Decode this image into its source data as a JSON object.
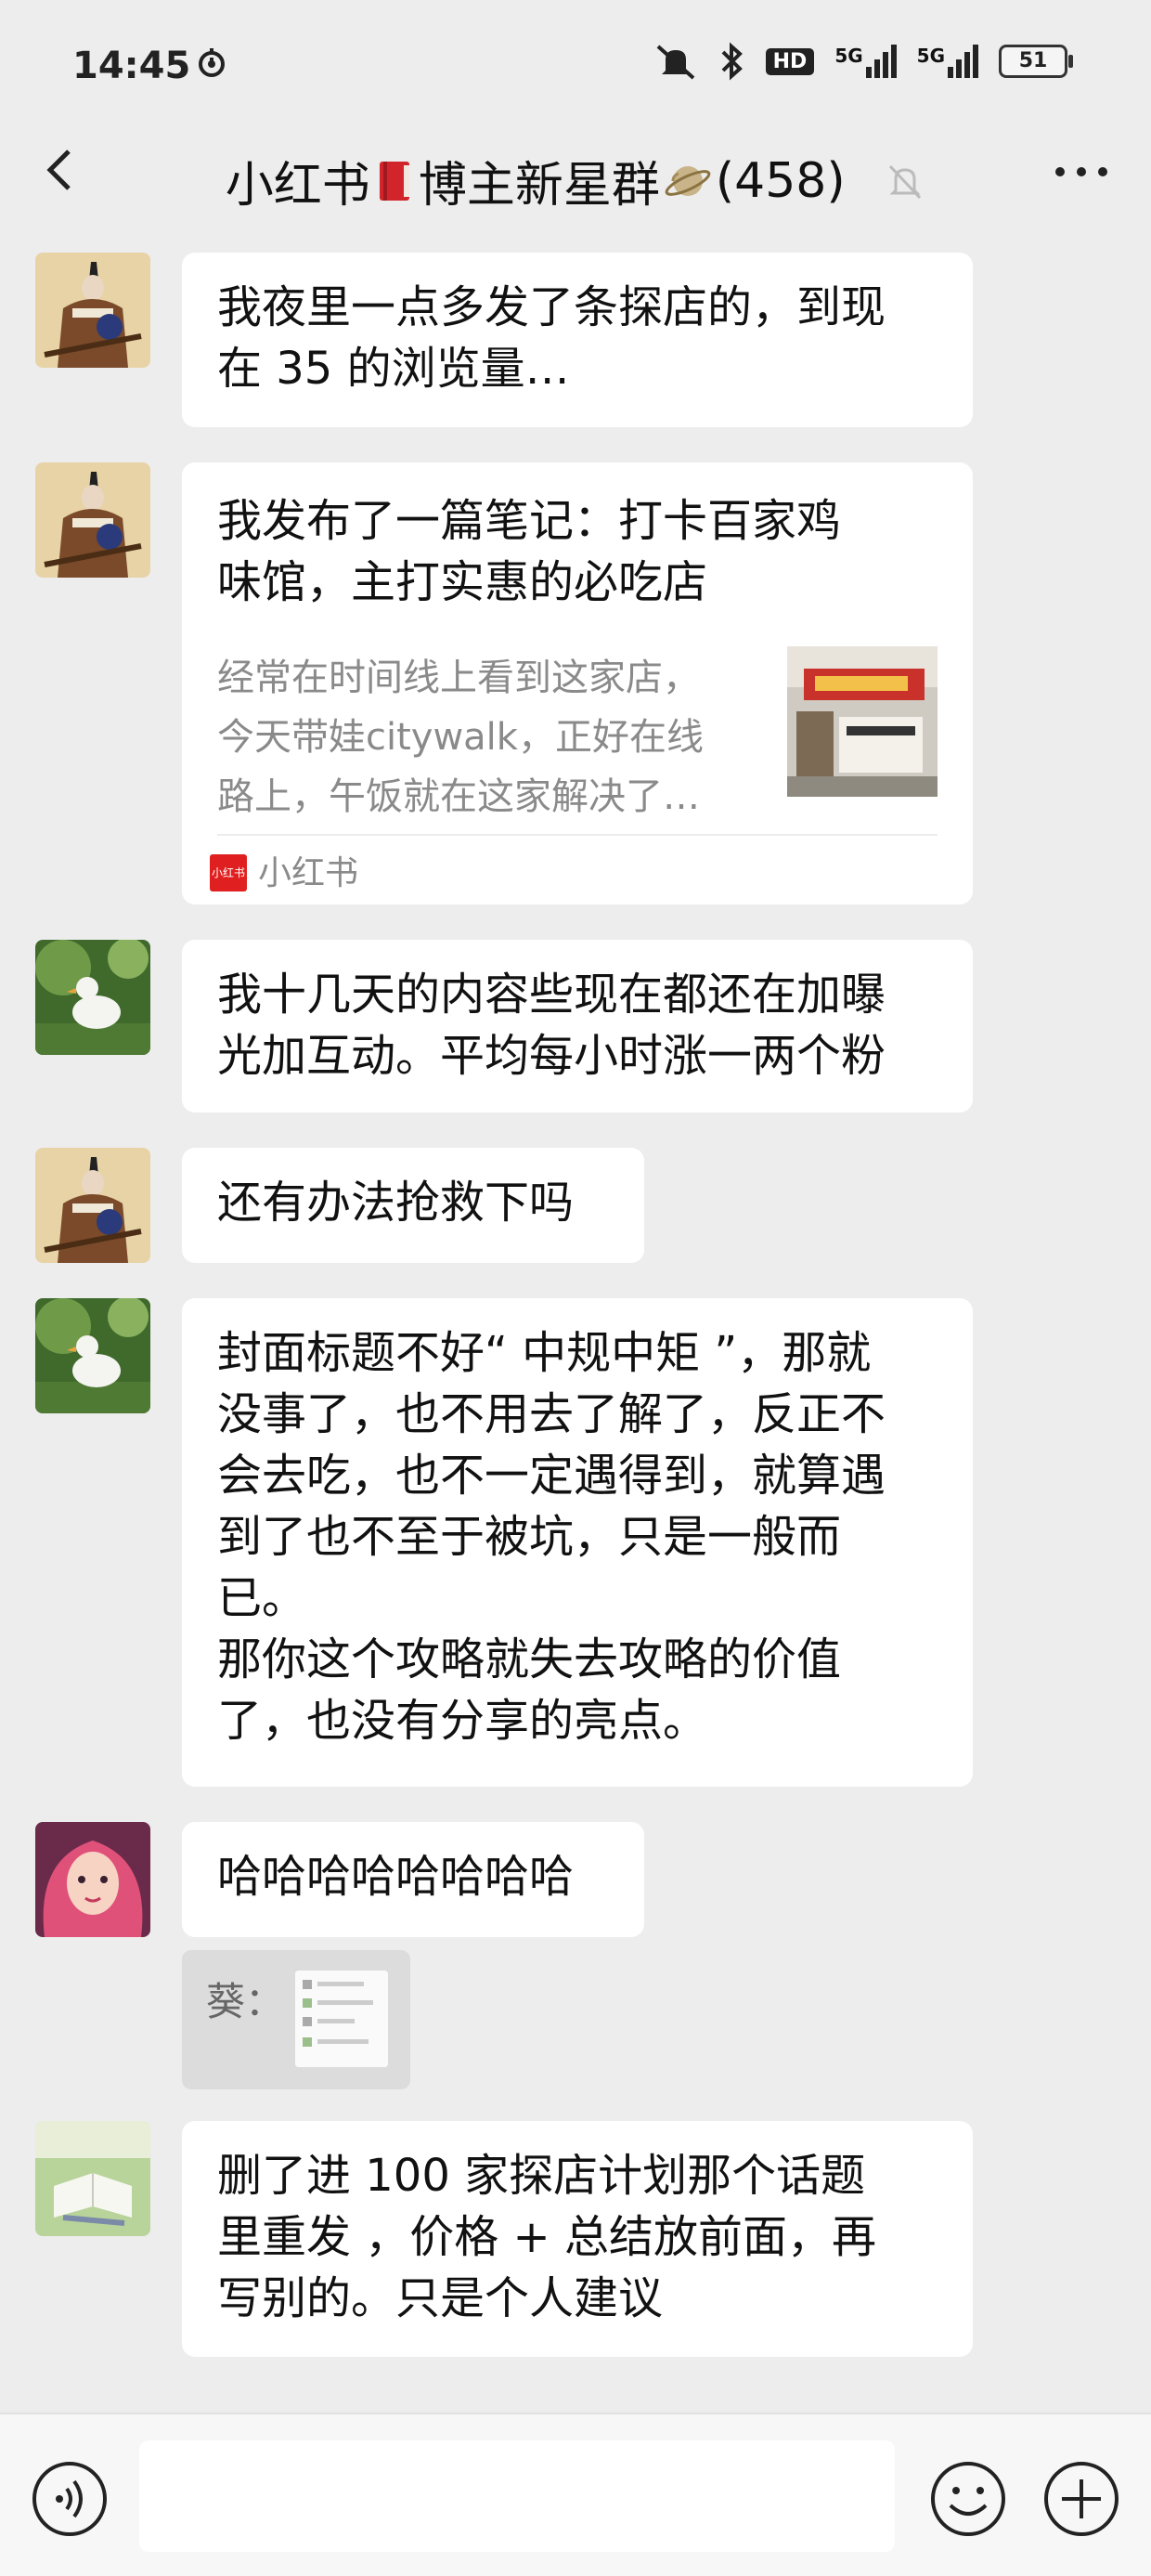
{
  "status_bar": {
    "time": "14:45",
    "network_1": "5G",
    "network_2": "5G",
    "hd": "HD",
    "battery": "51"
  },
  "header": {
    "title": "小红书",
    "title_suffix": "博主新星群",
    "member_count": "(458)",
    "icons": [
      "back-arrow-icon",
      "book-emoji-icon",
      "planet-emoji-icon",
      "mute-bell-icon",
      "more-icon"
    ]
  },
  "messages": [
    {
      "sender": "samurai",
      "lines": [
        "我夜里一点多发了条探店的，到现",
        "在 35 的浏览量…"
      ]
    },
    {
      "sender": "samurai",
      "card": {
        "title_lines": [
          "我发布了一篇笔记：打卡百家鸡",
          "味馆，主打实惠的必吃店"
        ],
        "desc_lines": [
          "经常在时间线上看到这家店，",
          "今天带娃citywalk，正好在线",
          "路上，午饭就在这家解决了…"
        ],
        "source": "小红书",
        "source_icon_text": "小红书"
      }
    },
    {
      "sender": "duck",
      "lines": [
        "我十几天的内容些现在都还在加曝",
        "光加互动。平均每小时涨一两个粉"
      ]
    },
    {
      "sender": "samurai",
      "lines": [
        "还有办法抢救下吗"
      ]
    },
    {
      "sender": "duck",
      "lines": [
        "封面标题不好“ 中规中矩 ”，那就",
        "没事了，也不用去了解了，反正不",
        "会去吃，也不一定遇得到，就算遇",
        "到了也不至于被坑，只是一般而",
        "已。",
        "那你这个攻略就失去攻略的价值",
        "了，也没有分享的亮点。"
      ]
    },
    {
      "sender": "girl",
      "lines": [
        "哈哈哈哈哈哈哈哈"
      ],
      "quote_label": "葵："
    },
    {
      "sender": "book",
      "lines": [
        "删了进 100 家探店计划那个话题",
        "里重发 ，价格 + 总结放前面，再",
        "写别的。只是个人建议"
      ]
    }
  ],
  "input_bar": {
    "placeholder": "",
    "icons": [
      "voice-icon",
      "emoji-icon",
      "plus-icon"
    ]
  },
  "colors": {
    "background": "#ededed",
    "bubble": "#ffffff",
    "muted_text": "#8a8a8a",
    "xhs_red": "#e02020"
  }
}
